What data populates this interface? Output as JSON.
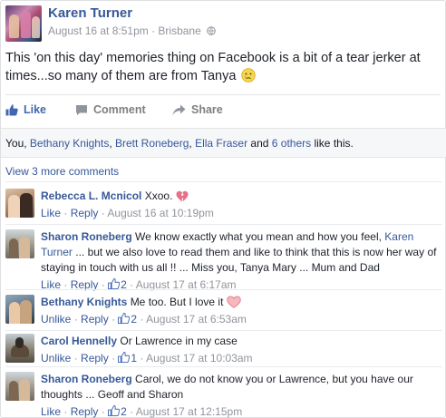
{
  "post": {
    "author": "Karen Turner",
    "date": "August 16 at 8:51pm",
    "location": "Brisbane",
    "text": "This 'on this day' memories thing on Facebook is a bit of a tear jerker at times...so many of them are from Tanya",
    "emoji": "crying-face"
  },
  "actions": {
    "like": "Like",
    "comment": "Comment",
    "share": "Share"
  },
  "likes": {
    "prefix": "You, ",
    "name1": "Bethany Knights",
    "sep1": ", ",
    "name2": "Brett Roneberg",
    "sep2": ", ",
    "name3": "Ella Fraser",
    "and": " and ",
    "others": "6 others",
    "suffix": " like this."
  },
  "view_more": "View 3 more comments",
  "comments": [
    {
      "name": "Rebecca L. Mcnicol",
      "text": "Xxoo.",
      "emoji": "broken-heart",
      "like": "Like",
      "reply": "Reply",
      "count": "",
      "time": "August 16 at 10:19pm"
    },
    {
      "name": "Sharon Roneberg",
      "text_a": "We know exactly what you mean and how you feel, ",
      "mention": "Karen Turner",
      "text_b": " ... but we also love to read them and like to think that this is now her way of staying in touch with us all !! ... Miss you, Tanya Mary ... Mum and Dad",
      "like": "Like",
      "reply": "Reply",
      "count": "2",
      "time": "August 17 at 6:17am"
    },
    {
      "name": "Bethany Knights",
      "text": "Me too. But I love it",
      "emoji": "heart",
      "like": "Unlike",
      "reply": "Reply",
      "count": "2",
      "time": "August 17 at 6:53am"
    },
    {
      "name": "Carol Hennelly",
      "text": "Or Lawrence in my case",
      "like": "Unlike",
      "reply": "Reply",
      "count": "1",
      "time": "August 17 at 10:03am"
    },
    {
      "name": "Sharon Roneberg",
      "text": "Carol, we do not know you or Lawrence, but you have our thoughts ... Geoff and Sharon",
      "like": "Like",
      "reply": "Reply",
      "count": "2",
      "time": "August 17 at 12:15pm"
    }
  ],
  "colors": {
    "link": "#365899",
    "meta": "#90949c",
    "like_blue": "#4267b2",
    "bar_bg": "#f6f7f9"
  }
}
